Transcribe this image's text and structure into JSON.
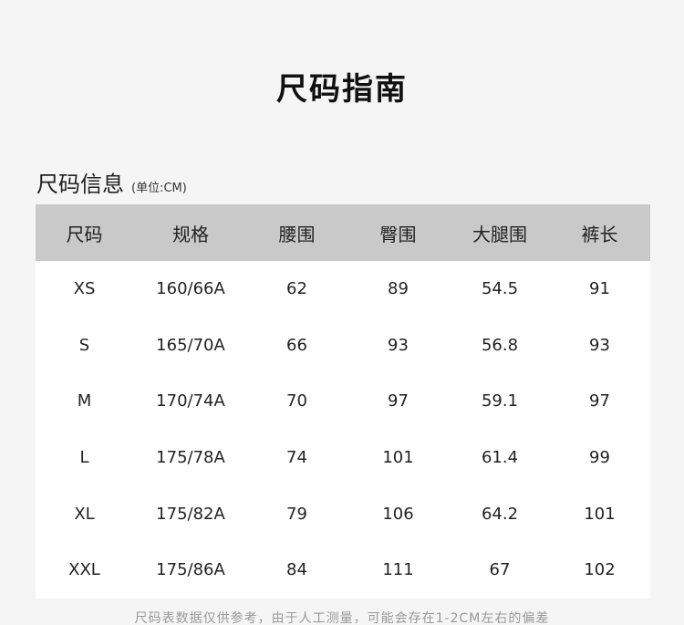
{
  "page": {
    "title": "尺码指南"
  },
  "section": {
    "title": "尺码信息",
    "unit": "(单位:CM)"
  },
  "table": {
    "headers": [
      "尺码",
      "规格",
      "腰围",
      "臀围",
      "大腿围",
      "裤长"
    ],
    "rows": [
      [
        "XS",
        "160/66A",
        "62",
        "89",
        "54.5",
        "91"
      ],
      [
        "S",
        "165/70A",
        "66",
        "93",
        "56.8",
        "93"
      ],
      [
        "M",
        "170/74A",
        "70",
        "97",
        "59.1",
        "97"
      ],
      [
        "L",
        "175/78A",
        "74",
        "101",
        "61.4",
        "99"
      ],
      [
        "XL",
        "175/82A",
        "79",
        "106",
        "64.2",
        "101"
      ],
      [
        "XXL",
        "175/86A",
        "84",
        "111",
        "67",
        "102"
      ]
    ]
  },
  "footnote": "尺码表数据仅供参考，由于人工测量，可能会存在1-2CM左右的偏差"
}
